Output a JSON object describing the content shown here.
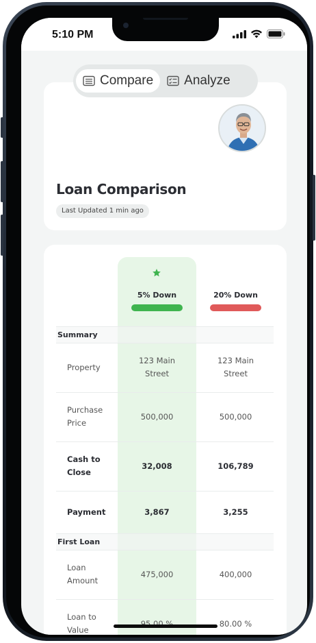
{
  "status_bar": {
    "time": "5:10 PM"
  },
  "tabs": [
    {
      "label": "Compare",
      "icon": "list-icon",
      "active": true
    },
    {
      "label": "Analyze",
      "icon": "checklist-icon",
      "active": false
    }
  ],
  "header": {
    "title": "Loan Comparison",
    "updated": "Last Updated 1 min ago"
  },
  "columns": [
    {
      "label": "5% Down",
      "color": "#3fb44f",
      "highlighted": true
    },
    {
      "label": "20% Down",
      "color": "#e05a5a",
      "highlighted": false
    }
  ],
  "sections": [
    {
      "label": "Summary"
    },
    {
      "label": "First Loan"
    }
  ],
  "rows": [
    {
      "label": "Property",
      "values": [
        "123 Main Street",
        "123 Main Street"
      ],
      "bold": false
    },
    {
      "label": "Purchase Price",
      "values": [
        "500,000",
        "500,000"
      ],
      "bold": false
    },
    {
      "label": "Cash to Close",
      "values": [
        "32,008",
        "106,789"
      ],
      "bold": true
    },
    {
      "label": "Payment",
      "values": [
        "3,867",
        "3,255"
      ],
      "bold": true
    },
    {
      "label": "Loan Amount",
      "values": [
        "475,000",
        "400,000"
      ],
      "bold": false
    },
    {
      "label": "Loan to Value",
      "values": [
        "95.00 %",
        "80.00 %"
      ],
      "bold": false
    }
  ]
}
